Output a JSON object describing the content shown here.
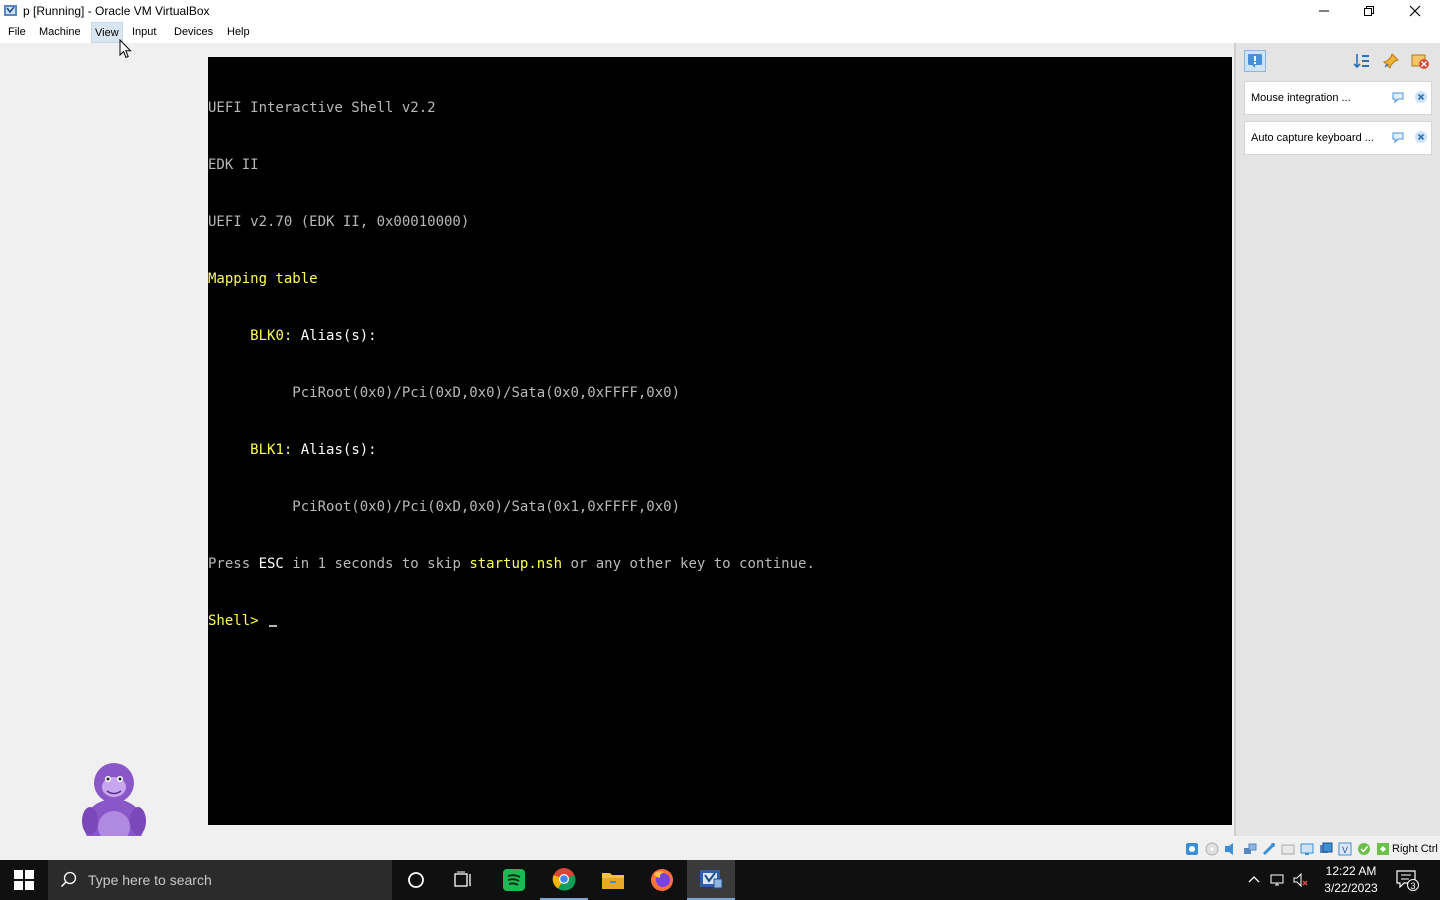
{
  "window": {
    "title": "p [Running] - Oracle VM VirtualBox"
  },
  "menu": {
    "items": [
      "File",
      "Machine",
      "View",
      "Input",
      "Devices",
      "Help"
    ],
    "active": "View"
  },
  "console": {
    "line1": "UEFI Interactive Shell v2.2",
    "line2": "EDK II",
    "line3": "UEFI v2.70 (EDK II, 0x00010000)",
    "line4": "Mapping table",
    "blk0_label": "BLK0:",
    "blk0_alias": "Alias(s):",
    "blk0_path": "PciRoot(0x0)/Pci(0xD,0x0)/Sata(0x0,0xFFFF,0x0)",
    "blk1_label": "BLK1:",
    "blk1_alias": "Alias(s):",
    "blk1_path": "PciRoot(0x0)/Pci(0xD,0x0)/Sata(0x1,0xFFFF,0x0)",
    "press_a": "Press ",
    "press_esc": "ESC",
    "press_b": " in 1 seconds to skip ",
    "press_file": "startup.nsh",
    "press_c": " or any other key to continue.",
    "prompt": "Shell> "
  },
  "notifications": {
    "items": [
      {
        "text": "Mouse integration ..."
      },
      {
        "text": "Auto capture keyboard ..."
      }
    ]
  },
  "statusbar": {
    "host_key": "Right Ctrl"
  },
  "taskbar": {
    "search_placeholder": "Type here to search",
    "time": "12:22 AM",
    "date": "3/22/2023",
    "notification_count": "3"
  },
  "colors": {
    "console_text": "#b8b8b8",
    "console_highlight": "#ffff55",
    "taskbar_bg": "#101010",
    "accent": "#7aa7d8"
  }
}
